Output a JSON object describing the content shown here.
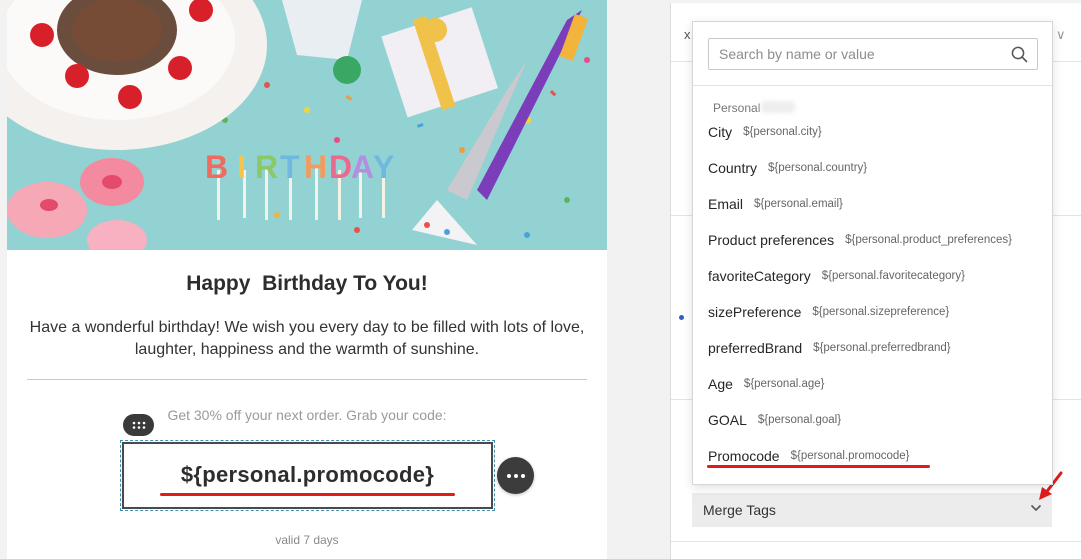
{
  "email": {
    "heading": "Happy  Birthday To You!",
    "body": "Have a wonderful birthday! We wish you every day to be filled with lots of love, laughter, happiness and the warmth of sunshine.",
    "offer": "Get 30% off your next order. Grab your code:",
    "code": "${personal.promocode}",
    "valid": "valid 7 days",
    "hero_candle_letters": [
      "B",
      "I",
      "R",
      "T",
      "H",
      "D",
      "A",
      "Y"
    ]
  },
  "dropdown": {
    "search_placeholder": "Search by name or value",
    "group_label": "Personal",
    "items": [
      {
        "name": "City",
        "value": "${personal.city}"
      },
      {
        "name": "Country",
        "value": "${personal.country}"
      },
      {
        "name": "Email",
        "value": "${personal.email}"
      },
      {
        "name": "Product preferences",
        "value": "${personal.product_preferences}"
      },
      {
        "name": "favoriteCategory",
        "value": "${personal.favoritecategory}"
      },
      {
        "name": "sizePreference",
        "value": "${personal.sizepreference}"
      },
      {
        "name": "preferredBrand",
        "value": "${personal.preferredbrand}"
      },
      {
        "name": "Age",
        "value": "${personal.age}"
      },
      {
        "name": "GOAL",
        "value": "${personal.goal}"
      },
      {
        "name": "Promocode",
        "value": "${personal.promocode}"
      }
    ]
  },
  "panel": {
    "merge_tags_label": "Merge Tags",
    "corner_left": "x",
    "corner_right": "∨"
  },
  "colors": {
    "annotation_red": "#e01b1b",
    "hero_bg": "#8fcfd0",
    "panel_dot": "#2f5fc4"
  },
  "icons": [
    "drag-handle-icon",
    "more-horizontal-icon",
    "search-icon",
    "chevron-down-icon",
    "annotation-arrow-icon"
  ]
}
